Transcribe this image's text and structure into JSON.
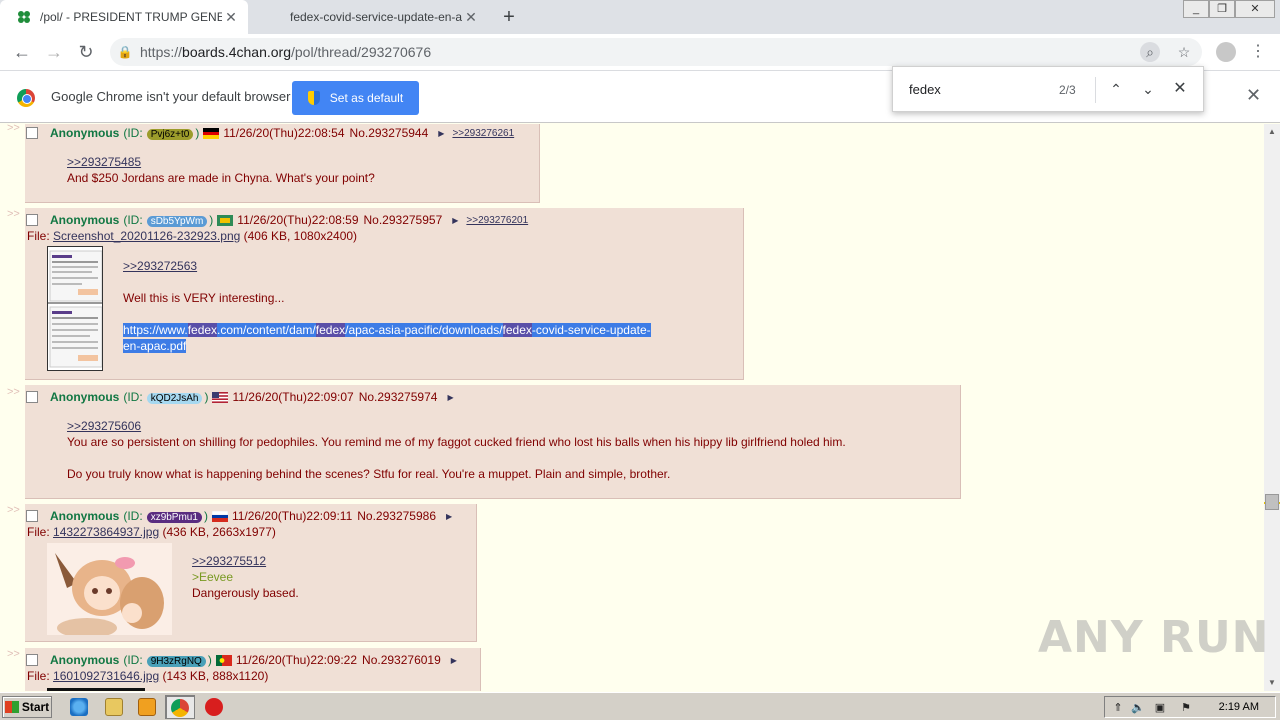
{
  "tabs": [
    {
      "title": "/pol/ - PRESIDENT TRUMP GENERAL",
      "active": true
    },
    {
      "title": "fedex-covid-service-update-en-apac",
      "active": false
    }
  ],
  "window_controls": [
    "_",
    "❐",
    "✕"
  ],
  "address_bar": {
    "scheme": "https://",
    "host": "boards.4chan.org",
    "path": "/pol/thread/293270676"
  },
  "infobar": {
    "message": "Google Chrome isn't your default browser",
    "button": "Set as default"
  },
  "find": {
    "query": "fedex",
    "count": "2/3"
  },
  "posts": [
    {
      "name": "Anonymous",
      "id_prefix": "(ID:",
      "id": "Pvj6z+t0",
      "id_suffix": ")",
      "id_color": "#9c9c2b",
      "datetime": "11/26/20(Thu)22:08:54",
      "number": "No.293275944",
      "backlink": ">>293276261",
      "quote": ">>293275485",
      "text": "And $250 Jordans are made in Chyna. What's your point?"
    },
    {
      "name": "Anonymous",
      "id_prefix": "(ID:",
      "id": "sDb5YpWm",
      "id_suffix": ")",
      "id_color": "#5b9bd5",
      "datetime": "11/26/20(Thu)22:08:59",
      "number": "No.293275957",
      "backlink": ">>293276201",
      "file_label": "File:",
      "file_name": "Screenshot_20201126-232923.png",
      "file_info": "(406 KB, 1080x2400)",
      "quote": ">>293272563",
      "text": "Well this is VERY interesting...",
      "link_parts": [
        "https://www.",
        "fedex",
        ".com/content/dam/",
        "fedex",
        "/apac-asia-pacific/downloads/",
        "fedex",
        "-covid-service-update-",
        "en-apac.pdf"
      ]
    },
    {
      "name": "Anonymous",
      "id_prefix": "(ID:",
      "id": "kQD2JsAh",
      "id_suffix": ")",
      "id_color": "#a6d8f0",
      "datetime": "11/26/20(Thu)22:09:07",
      "number": "No.293275974",
      "quote": ">>293275606",
      "text": "You are so persistent on shilling for pedophiles. You remind me of my faggot cucked friend who lost his balls when his hippy lib girlfriend holed him.",
      "text2": "Do you truly know what is happening behind the scenes? Stfu for real. You're a muppet. Plain and simple, brother."
    },
    {
      "name": "Anonymous",
      "id_prefix": "(ID:",
      "id": "xz9bPmu1",
      "id_suffix": ")",
      "id_color": "#5a2c80",
      "datetime": "11/26/20(Thu)22:09:11",
      "number": "No.293275986",
      "file_label": "File:",
      "file_name": "1432273864937.jpg",
      "file_info": "(436 KB, 2663x1977)",
      "quote": ">>293275512",
      "greentext": ">Eevee",
      "text": "Dangerously based."
    },
    {
      "name": "Anonymous",
      "id_prefix": "(ID:",
      "id": "9H3zRgNQ",
      "id_suffix": ")",
      "id_color": "#4aa0b8",
      "datetime": "11/26/20(Thu)22:09:22",
      "number": "No.293276019",
      "file_label": "File:",
      "file_name": "1601092731646.jpg",
      "file_info": "(143 KB, 888x1120)"
    }
  ],
  "taskbar": {
    "start": "Start",
    "clock": "2:19 AM"
  },
  "watermark": "ANY RUN"
}
